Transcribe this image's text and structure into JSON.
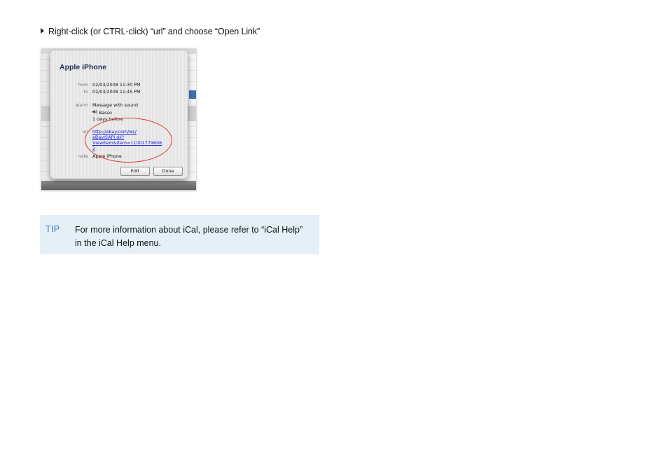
{
  "instruction": {
    "text": "Right-click (or CTRL-click) “url” and choose “Open Link”"
  },
  "event_popup": {
    "title": "Apple iPhone",
    "rows": [
      {
        "label": "from",
        "value": "02/03/2008 11:30 PM"
      },
      {
        "label": "to",
        "value": "02/03/2008 11:45 PM"
      },
      {
        "label": "alarm",
        "value": "Message with sound"
      }
    ],
    "alarm_sound": "Basso",
    "alarm_offset": "1 days before",
    "url_label": "url",
    "url_lines": [
      "http://ebay.com/ws/",
      "eBayISAPI.dll?",
      "ViewItem&item=11002779608",
      "2"
    ],
    "note_label": "note",
    "note_value": "Apple iPhone",
    "edit_label": "Edit",
    "done_label": "Done"
  },
  "tip": {
    "label": "TIP",
    "text": "For more information about iCal, please refer to “iCal Help” in the iCal Help menu."
  },
  "colors": {
    "tip_background": "#e4eff6",
    "tip_label": "#2d7db3",
    "highlight_ring": "#e23a2a",
    "link": "#1a26d6"
  }
}
